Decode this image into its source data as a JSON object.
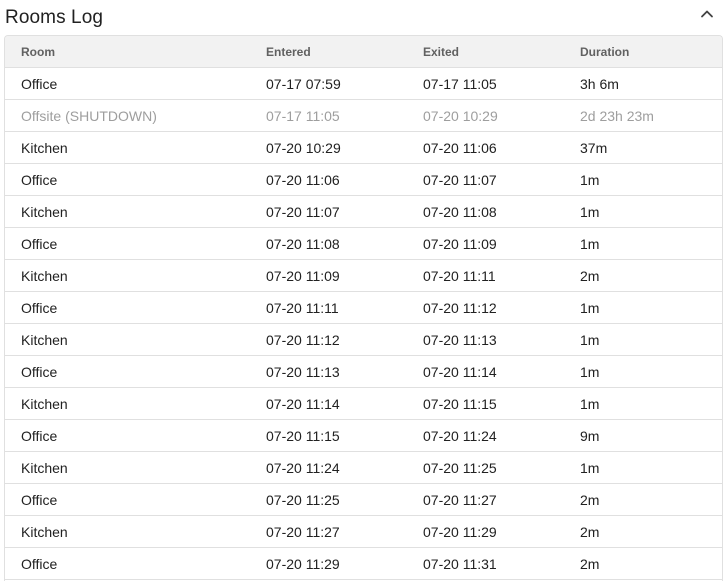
{
  "panel": {
    "title": "Rooms Log",
    "collapse_icon": "chevron-up-icon"
  },
  "table": {
    "columns": [
      "Room",
      "Entered",
      "Exited",
      "Duration"
    ],
    "rows": [
      {
        "room": "Office",
        "entered": "07-17 07:59",
        "exited": "07-17 11:05",
        "duration": "3h 6m",
        "muted": false
      },
      {
        "room": "Offsite (SHUTDOWN)",
        "entered": "07-17 11:05",
        "exited": "07-20 10:29",
        "duration": "2d 23h 23m",
        "muted": true
      },
      {
        "room": "Kitchen",
        "entered": "07-20 10:29",
        "exited": "07-20 11:06",
        "duration": "37m",
        "muted": false
      },
      {
        "room": "Office",
        "entered": "07-20 11:06",
        "exited": "07-20 11:07",
        "duration": "1m",
        "muted": false
      },
      {
        "room": "Kitchen",
        "entered": "07-20 11:07",
        "exited": "07-20 11:08",
        "duration": "1m",
        "muted": false
      },
      {
        "room": "Office",
        "entered": "07-20 11:08",
        "exited": "07-20 11:09",
        "duration": "1m",
        "muted": false
      },
      {
        "room": "Kitchen",
        "entered": "07-20 11:09",
        "exited": "07-20 11:11",
        "duration": "2m",
        "muted": false
      },
      {
        "room": "Office",
        "entered": "07-20 11:11",
        "exited": "07-20 11:12",
        "duration": "1m",
        "muted": false
      },
      {
        "room": "Kitchen",
        "entered": "07-20 11:12",
        "exited": "07-20 11:13",
        "duration": "1m",
        "muted": false
      },
      {
        "room": "Office",
        "entered": "07-20 11:13",
        "exited": "07-20 11:14",
        "duration": "1m",
        "muted": false
      },
      {
        "room": "Kitchen",
        "entered": "07-20 11:14",
        "exited": "07-20 11:15",
        "duration": "1m",
        "muted": false
      },
      {
        "room": "Office",
        "entered": "07-20 11:15",
        "exited": "07-20 11:24",
        "duration": "9m",
        "muted": false
      },
      {
        "room": "Kitchen",
        "entered": "07-20 11:24",
        "exited": "07-20 11:25",
        "duration": "1m",
        "muted": false
      },
      {
        "room": "Office",
        "entered": "07-20 11:25",
        "exited": "07-20 11:27",
        "duration": "2m",
        "muted": false
      },
      {
        "room": "Kitchen",
        "entered": "07-20 11:27",
        "exited": "07-20 11:29",
        "duration": "2m",
        "muted": false
      },
      {
        "room": "Office",
        "entered": "07-20 11:29",
        "exited": "07-20 11:31",
        "duration": "2m",
        "muted": false
      }
    ]
  },
  "colors": {
    "text": "#212121",
    "muted_text": "#9e9e9e",
    "header_bg": "#f2f2f2",
    "header_text": "#616161",
    "border": "#e0e0e0"
  }
}
